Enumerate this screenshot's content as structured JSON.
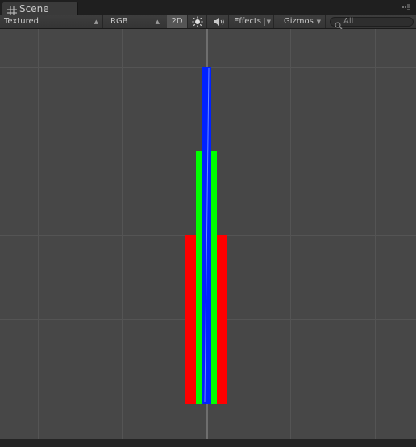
{
  "tab": {
    "title": "Scene",
    "icon": "grid-icon",
    "menu_icon": "kebab-menu-icon"
  },
  "toolbar": {
    "draw_mode": "Textured",
    "render_mode": "RGB",
    "two_d_label": "2D",
    "two_d_active": true,
    "lighting_icon": "sun-icon",
    "audio_icon": "speaker-icon",
    "effects_label": "Effects",
    "gizmos_label": "Gizmos",
    "dropdown_icon": "chevron-down-icon",
    "search_placeholder": "All",
    "search_icon": "search-icon"
  },
  "scene": {
    "background_color": "#474747",
    "grid_color": "#545454",
    "objects": [
      {
        "name": "red-bar",
        "color": "#ff0000"
      },
      {
        "name": "green-bar",
        "color": "#00ff00"
      },
      {
        "name": "blue-bar",
        "color": "#0022ff"
      }
    ]
  }
}
